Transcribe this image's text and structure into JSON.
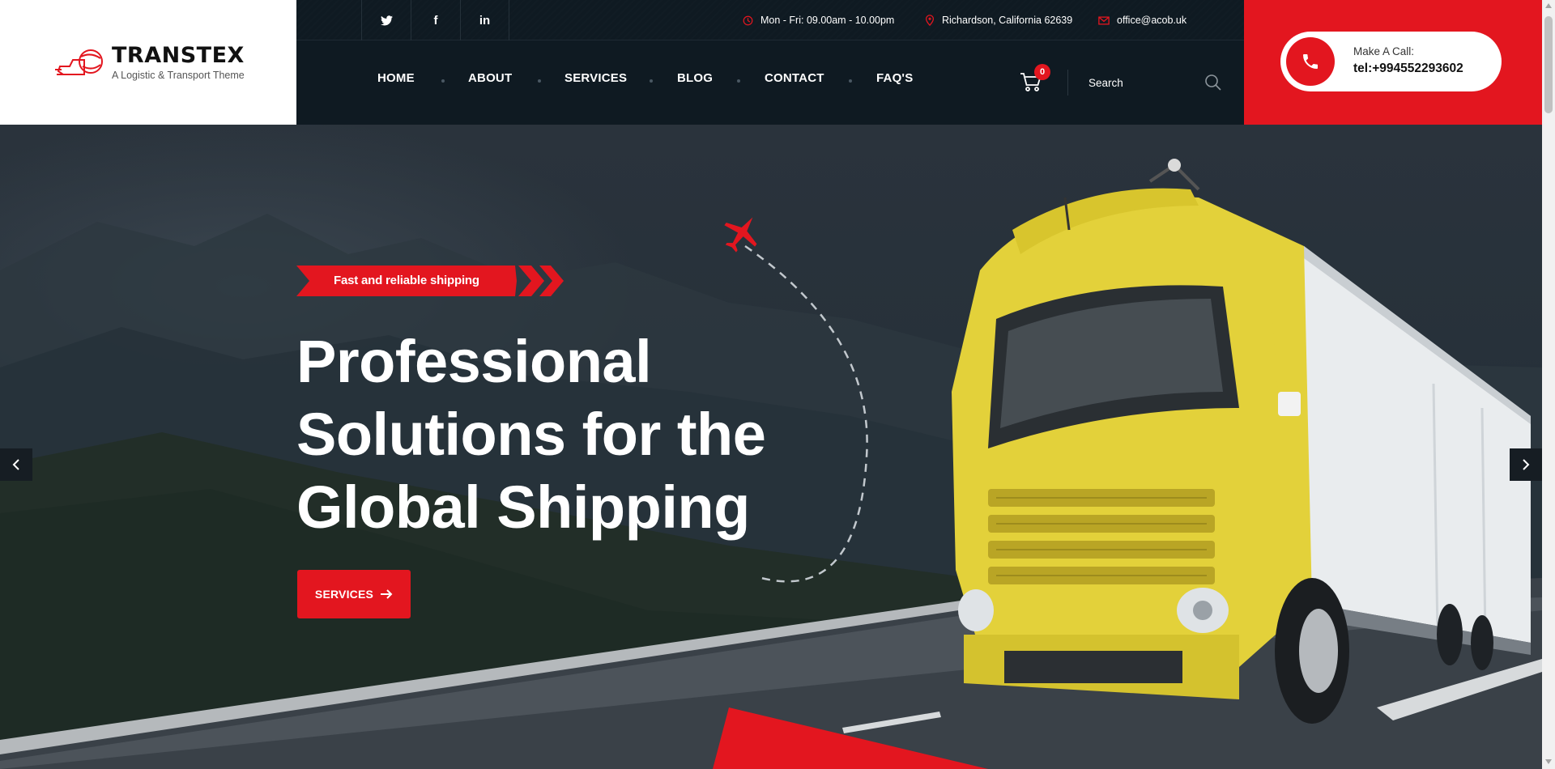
{
  "brand": {
    "name": "TRANSTEX",
    "tagline": "A Logistic & Transport Theme"
  },
  "topbar": {
    "social": [
      {
        "name": "twitter",
        "glyph": "twitter-icon"
      },
      {
        "name": "facebook",
        "glyph": "f"
      },
      {
        "name": "linkedin",
        "glyph": "in"
      }
    ],
    "hours": "Mon - Fri: 09.00am - 10.00pm",
    "address": "Richardson, California 62639",
    "email": "office@acob.uk"
  },
  "nav": {
    "items": [
      "HOME",
      "ABOUT",
      "SERVICES",
      "BLOG",
      "CONTACT",
      "FAQ'S"
    ],
    "cart_count": "0",
    "search_placeholder": "Search"
  },
  "call": {
    "label": "Make A Call:",
    "number": "tel:+994552293602"
  },
  "hero": {
    "badge": "Fast and reliable shipping",
    "headline": "Professional Solutions for the Global Shipping",
    "button": "SERVICES",
    "button_arrow": "⟶"
  },
  "colors": {
    "accent": "#e3161f",
    "header_dark": "#0f1a22",
    "truck_yellow": "#e3d13a"
  }
}
